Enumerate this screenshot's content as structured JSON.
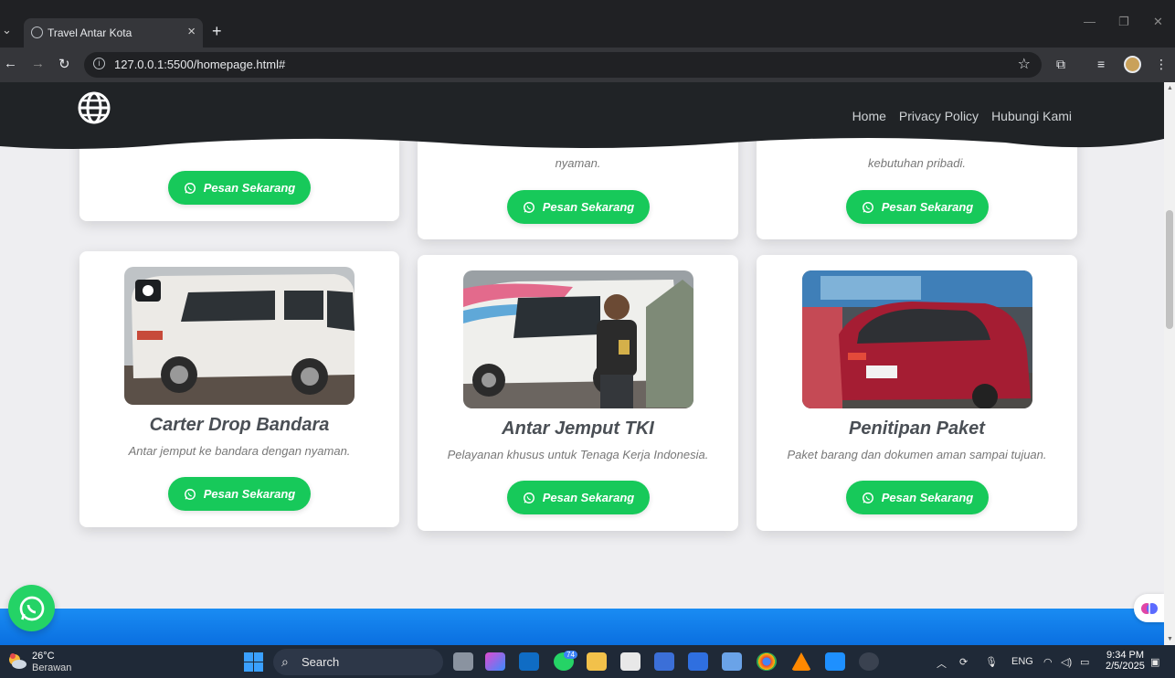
{
  "browser": {
    "tab_title": "Travel Antar Kota",
    "url": "127.0.0.1:5500/homepage.html#"
  },
  "nav": {
    "items": [
      "Home",
      "Privacy Policy",
      "Hubungi Kami"
    ]
  },
  "cards_top": [
    {
      "desc_line": "",
      "button": "Pesan Sekarang"
    },
    {
      "desc_line": "nyaman.",
      "button": "Pesan Sekarang"
    },
    {
      "desc_line": "kebutuhan pribadi.",
      "button": "Pesan Sekarang"
    }
  ],
  "cards": [
    {
      "title": "Carter Drop Bandara",
      "desc": "Antar jemput ke bandara dengan nyaman.",
      "button": "Pesan Sekarang"
    },
    {
      "title": "Antar Jemput TKI",
      "desc": "Pelayanan khusus untuk Tenaga Kerja Indonesia.",
      "button": "Pesan Sekarang"
    },
    {
      "title": "Penitipan Paket",
      "desc": "Paket barang dan dokumen aman sampai tujuan.",
      "button": "Pesan Sekarang"
    }
  ],
  "taskbar": {
    "temp": "26°C",
    "weather": "Berawan",
    "search": "Search",
    "lang": "ENG",
    "time": "9:34 PM",
    "date": "2/5/2025",
    "whatsapp_badge": "74"
  },
  "colors": {
    "header": "#202326",
    "button_green": "#17c95a",
    "footer_blue": "#1a8cf3"
  }
}
